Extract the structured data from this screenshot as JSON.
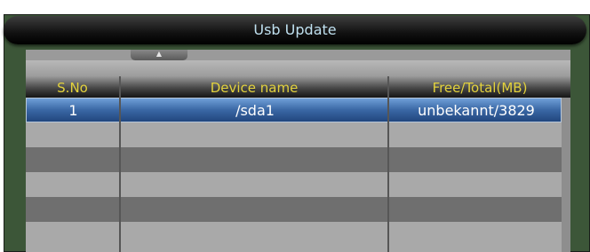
{
  "window": {
    "title": "Usb Update"
  },
  "table": {
    "scroll_up_indicator": "▲",
    "columns": [
      "S.No",
      "Device name",
      "Free/Total(MB)"
    ],
    "rows": [
      {
        "sno": "1",
        "device": "/sda1",
        "free_total": "unbekannt/3829",
        "selected": true
      }
    ],
    "empty_rows_visible": 5
  },
  "colors": {
    "title_text": "#bfe0ef",
    "header_text": "#e3d23c",
    "selection": "#3a67a4",
    "frame": "#3c5638"
  }
}
